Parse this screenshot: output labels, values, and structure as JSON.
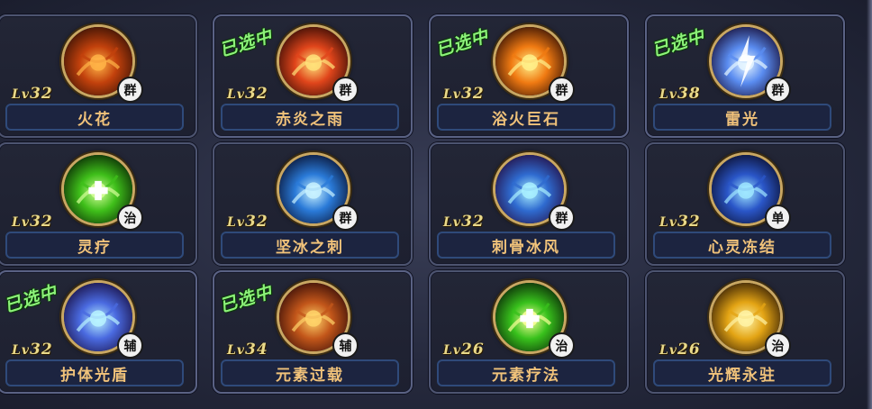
{
  "selected_label": "已选中",
  "level_prefix": "Lv",
  "skills": [
    {
      "name": "火花",
      "level": "32",
      "type": "群",
      "selected": false,
      "icon": "fire-spark-icon",
      "palette": [
        "#ffb347",
        "#c2410c",
        "#3a1205"
      ]
    },
    {
      "name": "赤炎之雨",
      "level": "32",
      "type": "群",
      "selected": true,
      "icon": "fire-rain-icon",
      "palette": [
        "#ffe27a",
        "#e0451b",
        "#3a0d05"
      ]
    },
    {
      "name": "浴火巨石",
      "level": "32",
      "type": "群",
      "selected": true,
      "icon": "flaming-boulder-icon",
      "palette": [
        "#fff08a",
        "#f07a12",
        "#3b1404"
      ]
    },
    {
      "name": "雷光",
      "level": "38",
      "type": "群",
      "selected": true,
      "icon": "lightning-icon",
      "palette": [
        "#e6f6ff",
        "#5a8cf0",
        "#1a1440"
      ]
    },
    {
      "name": "灵疗",
      "level": "32",
      "type": "治",
      "selected": false,
      "icon": "healing-cross-icon",
      "palette": [
        "#d6ff9a",
        "#3fbf1a",
        "#0a2a05"
      ]
    },
    {
      "name": "坚冰之刺",
      "level": "32",
      "type": "群",
      "selected": false,
      "icon": "ice-spikes-icon",
      "palette": [
        "#c9f2ff",
        "#2a7ad8",
        "#0a1638"
      ]
    },
    {
      "name": "刺骨冰风",
      "level": "32",
      "type": "群",
      "selected": false,
      "icon": "frost-wind-icon",
      "palette": [
        "#a9f0ff",
        "#2f6bd0",
        "#24124a"
      ]
    },
    {
      "name": "心灵冻结",
      "level": "32",
      "type": "单",
      "selected": false,
      "icon": "mind-freeze-icon",
      "palette": [
        "#9fe6ff",
        "#2a56c8",
        "#0c1236"
      ]
    },
    {
      "name": "护体光盾",
      "level": "32",
      "type": "辅",
      "selected": true,
      "icon": "light-shield-icon",
      "palette": [
        "#b9f3ff",
        "#4a6ae0",
        "#1a1248"
      ]
    },
    {
      "name": "元素过载",
      "level": "34",
      "type": "辅",
      "selected": true,
      "icon": "element-overload-icon",
      "palette": [
        "#ffd36a",
        "#c2561a",
        "#3b0f08"
      ]
    },
    {
      "name": "元素疗法",
      "level": "26",
      "type": "治",
      "selected": false,
      "icon": "element-therapy-icon",
      "palette": [
        "#fbff9a",
        "#38c11c",
        "#0b2a08"
      ]
    },
    {
      "name": "光辉永驻",
      "level": "26",
      "type": "治",
      "selected": false,
      "icon": "radiance-icon",
      "palette": [
        "#fff3a6",
        "#e3a414",
        "#3a2205"
      ]
    }
  ]
}
